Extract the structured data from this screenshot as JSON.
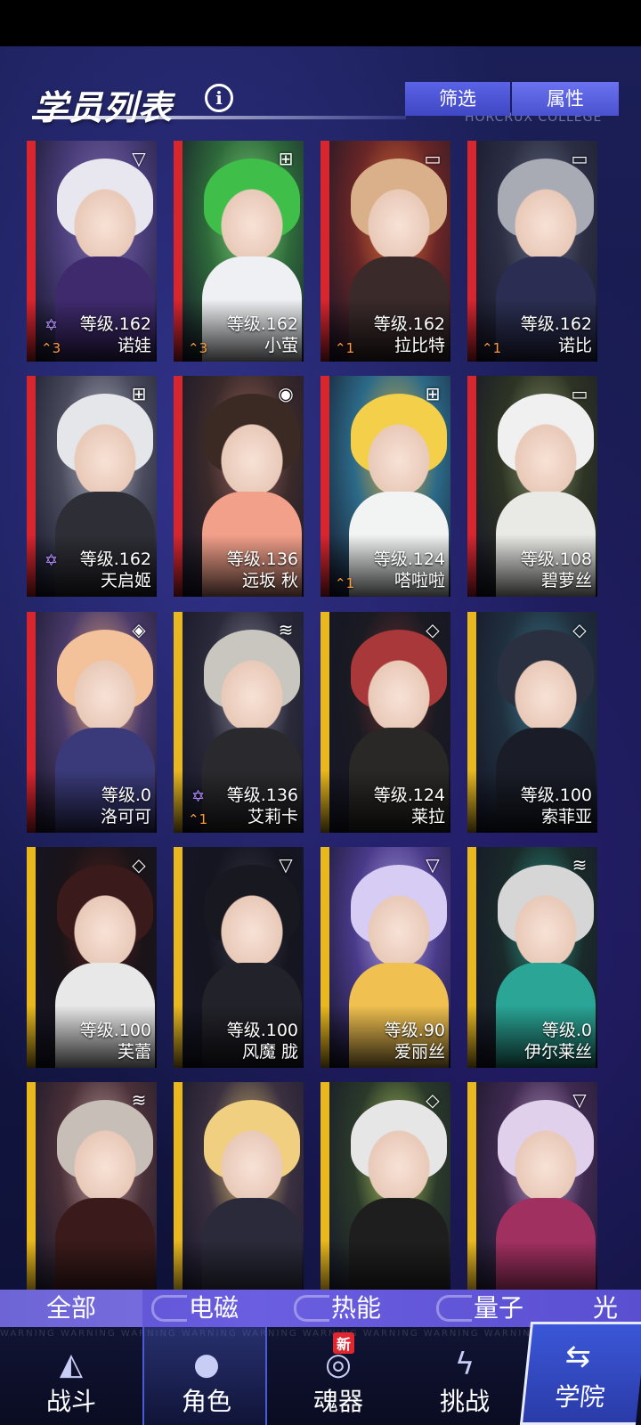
{
  "header": {
    "title": "学员列表",
    "subtitle_en": "HORCRUX COLLEGE",
    "filter_label": "筛选",
    "attribute_label": "属性"
  },
  "cards": [
    {
      "name": "诺娃",
      "level": "等级.162",
      "rank": "3",
      "element": "void-icon",
      "stripe": "#d8262f",
      "has_star": true
    },
    {
      "name": "小萤",
      "level": "等级.162",
      "rank": "3",
      "element": "grid-icon",
      "stripe": "#d8262f",
      "has_star": false
    },
    {
      "name": "拉比特",
      "level": "等级.162",
      "rank": "1",
      "element": "battery-icon",
      "stripe": "#d8262f",
      "has_star": false
    },
    {
      "name": "诺比",
      "level": "等级.162",
      "rank": "1",
      "element": "battery-icon",
      "stripe": "#d8262f",
      "has_star": false
    },
    {
      "name": "天启姬",
      "level": "等级.162",
      "rank": "",
      "element": "grid-icon",
      "stripe": "#d8262f",
      "has_star": true
    },
    {
      "name": "远坂 秋",
      "level": "等级.136",
      "rank": "",
      "element": "spiral-icon",
      "stripe": "#d8262f",
      "has_star": false
    },
    {
      "name": "嗒啦啦",
      "level": "等级.124",
      "rank": "1",
      "element": "grid-icon",
      "stripe": "#d8262f",
      "has_star": false
    },
    {
      "name": "碧萝丝",
      "level": "等级.108",
      "rank": "",
      "element": "battery-icon",
      "stripe": "#d8262f",
      "has_star": false
    },
    {
      "name": "洛可可",
      "level": "等级.0",
      "rank": "",
      "element": "dice-icon",
      "stripe": "#d8262f",
      "has_star": false
    },
    {
      "name": "艾莉卡",
      "level": "等级.136",
      "rank": "1",
      "element": "wifi-icon",
      "stripe": "#e8b81e",
      "has_star": true
    },
    {
      "name": "莱拉",
      "level": "等级.124",
      "rank": "",
      "element": "diamond-icon",
      "stripe": "#e8b81e",
      "has_star": false
    },
    {
      "name": "索菲亚",
      "level": "等级.100",
      "rank": "",
      "element": "diamond-icon",
      "stripe": "#e8b81e",
      "has_star": false
    },
    {
      "name": "芙蕾",
      "level": "等级.100",
      "rank": "",
      "element": "diamond-icon",
      "stripe": "#e8b81e",
      "has_star": false
    },
    {
      "name": "风魔 胧",
      "level": "等级.100",
      "rank": "",
      "element": "void-icon",
      "stripe": "#e8b81e",
      "has_star": false
    },
    {
      "name": "爱丽丝",
      "level": "等级.90",
      "rank": "",
      "element": "void-icon",
      "stripe": "#e8b81e",
      "has_star": false
    },
    {
      "name": "伊尔莱丝",
      "level": "等级.0",
      "rank": "",
      "element": "wifi-icon",
      "stripe": "#e8b81e",
      "has_star": false
    },
    {
      "name": "",
      "level": "",
      "rank": "",
      "element": "wifi-icon",
      "stripe": "#e8b81e",
      "has_star": false
    },
    {
      "name": "",
      "level": "",
      "rank": "",
      "element": "",
      "stripe": "#e8b81e",
      "has_star": false
    },
    {
      "name": "",
      "level": "",
      "rank": "",
      "element": "diamond-icon",
      "stripe": "#e8b81e",
      "has_star": false
    },
    {
      "name": "",
      "level": "",
      "rank": "",
      "element": "void-icon",
      "stripe": "#e8b81e",
      "has_star": false
    }
  ],
  "tabs": [
    "全部",
    "电磁",
    "热能",
    "量子",
    "光"
  ],
  "nav": [
    {
      "label": "战斗",
      "icon": "battle-icon"
    },
    {
      "label": "角色",
      "icon": "character-icon"
    },
    {
      "label": "魂器",
      "icon": "soulware-icon",
      "badge": "新"
    },
    {
      "label": "挑战",
      "icon": "challenge-icon"
    },
    {
      "label": "学院",
      "icon": "academy-icon"
    }
  ],
  "nav_warning_text": "WARNING WARNING WARNING WARNING WARNING WARNING WARNING WARNING WARNING WARNING WARNING WARNING"
}
